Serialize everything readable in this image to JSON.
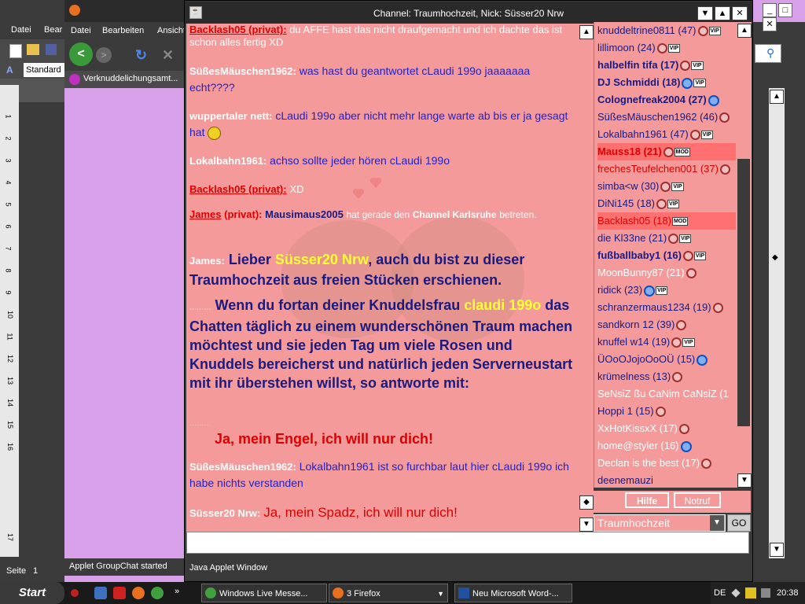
{
  "word": {
    "menu": [
      "Datei",
      "Bear"
    ],
    "style_value": "Standard",
    "ruler_numbers": [
      "1",
      "2",
      "3",
      "4",
      "5",
      "6",
      "7",
      "8",
      "9",
      "10",
      "11",
      "12",
      "13",
      "14",
      "15",
      "16",
      "17"
    ],
    "status_page": "Seite",
    "status_page_num": "1"
  },
  "firefox": {
    "menu": [
      "Datei",
      "Bearbeiten",
      "Ansicht"
    ],
    "tab_label": "Verknuddelichungsamt...",
    "status": "Applet GroupChat started"
  },
  "chat": {
    "title": "Channel: Traumhochzeit,  Nick: Süsser20 Nrw",
    "status": "Java Applet Window",
    "messages": [
      {
        "nick": "Backlash05 (privat):",
        "text": "du AFFE hast das nicht draufgemacht und ich dachte das ist schon alles fertig XD"
      },
      {
        "nick": "SüßesMäuschen1962:",
        "text": "was hast du geantwortet cLaudi 199o jaaaaaaa echt????"
      },
      {
        "nick": "wuppertaler nett:",
        "text": "cLaudi 199o aber nicht mehr lange warte ab bis er ja gesagt hat"
      },
      {
        "nick": "Lokalbahn1961:",
        "text": "achso sollte jeder hören cLaudi 199o"
      },
      {
        "nick": "Backlash05 (privat):",
        "text": "XD"
      },
      {
        "nick": "James",
        "nick_suffix": "(privat):",
        "user": "Mausimaus2005",
        "text": "hat gerade den",
        "channel": "Channel Karlsruhe",
        "text2": "betreten."
      },
      {
        "nick": "James:",
        "text1": "Lieber",
        "name1": "Süsser20 Nrw",
        "text2": ", auch du bist zu dieser Traumhochzeit aus freien Stücken erschienen."
      },
      {
        "dots": ".........",
        "text1": "Wenn du fortan deiner Knuddelsfrau",
        "name2": "claudi 199o",
        "text2": "das Chatten täglich zu einem wunderschönen Traum machen möchtest und sie jeden Tag um viele Rosen und Knuddels bereicherst und natürlich jeden Serverneustart mit ihr überstehen willst, so antworte mit:"
      },
      {
        "dots": ".........",
        "text": "Ja, mein Engel, ich will nur dich!"
      },
      {
        "nick": "SüßesMäuschen1962:",
        "text": "Lokalbahn1961  ist so furchbar laut hier cLaudi 199o  ich habe nichts verstanden"
      },
      {
        "nick": "Süsser20 Nrw:",
        "text": "Ja, mein Spadz, ich will nur dich!"
      }
    ]
  },
  "users": [
    {
      "name": "knuddeltrine0811 (47)",
      "style": "blue",
      "icon": "female",
      "badge": "VIP"
    },
    {
      "name": "lillimoon (24)",
      "style": "blue",
      "icon": "female",
      "badge": "VIP"
    },
    {
      "name": "halbelfin tifa (17)",
      "style": "blue-bold",
      "icon": "female",
      "badge": "VIP"
    },
    {
      "name": "DJ Schmiddi (18)",
      "style": "blue-bold",
      "icon": "male",
      "badge": "VIP"
    },
    {
      "name": "Colognefreak2004 (27)",
      "style": "blue-bold",
      "icon": "male",
      "badge": ""
    },
    {
      "name": "SüßesMäuschen1962 (46)",
      "style": "blue",
      "icon": "female",
      "badge": ""
    },
    {
      "name": "Lokalbahn1961 (47)",
      "style": "blue",
      "icon": "female",
      "badge": "VIP"
    },
    {
      "name": "Mauss18 (21)",
      "style": "red-bold",
      "icon": "female",
      "badge": "MOD",
      "highlight": true
    },
    {
      "name": "frechesTeufelchen001 (37)",
      "style": "red",
      "icon": "female",
      "badge": ""
    },
    {
      "name": "simba<w (30)",
      "style": "blue",
      "icon": "female",
      "badge": "VIP"
    },
    {
      "name": "DiNi145 (18)",
      "style": "blue",
      "icon": "female",
      "badge": "VIP"
    },
    {
      "name": "Backlash05 (18)",
      "style": "red",
      "icon": "",
      "badge": "MOD",
      "highlight": true
    },
    {
      "name": "die Kl33ne (21)",
      "style": "blue",
      "icon": "female",
      "badge": "VIP"
    },
    {
      "name": "fußballbaby1 (16)",
      "style": "blue-bold",
      "icon": "female",
      "badge": "VIP"
    },
    {
      "name": "MoonBunny87 (21)",
      "style": "white",
      "icon": "female",
      "badge": ""
    },
    {
      "name": "ridick (23)",
      "style": "blue",
      "icon": "male",
      "badge": "VIP"
    },
    {
      "name": "schranzermaus1234 (19)",
      "style": "blue",
      "icon": "female",
      "badge": ""
    },
    {
      "name": "sandkorn 12 (39)",
      "style": "blue",
      "icon": "female",
      "badge": ""
    },
    {
      "name": "knuffel w14 (19)",
      "style": "blue",
      "icon": "female",
      "badge": "VIP"
    },
    {
      "name": "ÜOoOJojoOoOÜ (15)",
      "style": "blue",
      "icon": "male",
      "badge": ""
    },
    {
      "name": "krümelness (13)",
      "style": "blue",
      "icon": "female",
      "badge": ""
    },
    {
      "name": "SeNsiZ ßu CaNim CaNsiZ (1",
      "style": "white",
      "icon": "",
      "badge": ""
    },
    {
      "name": "Hoppi 1 (15)",
      "style": "blue",
      "icon": "female",
      "badge": ""
    },
    {
      "name": "XxHotKissxX (17)",
      "style": "white",
      "icon": "female",
      "badge": ""
    },
    {
      "name": "home@styler (16)",
      "style": "white",
      "icon": "male",
      "badge": ""
    },
    {
      "name": "Declan is the best (17)",
      "style": "white",
      "icon": "female",
      "badge": ""
    },
    {
      "name": "deenemauzi",
      "style": "blue",
      "icon": "",
      "badge": ""
    }
  ],
  "controls": {
    "help_label": "Hilfe",
    "emergency_label": "Notruf",
    "channel_value": "Traumhochzeit",
    "go_label": "GO"
  },
  "taskbar": {
    "start_label": "Start",
    "tasks": [
      "Windows Live Messe...",
      "3 Firefox",
      "Neu Microsoft Word-..."
    ],
    "language": "DE",
    "time": "20:38"
  }
}
